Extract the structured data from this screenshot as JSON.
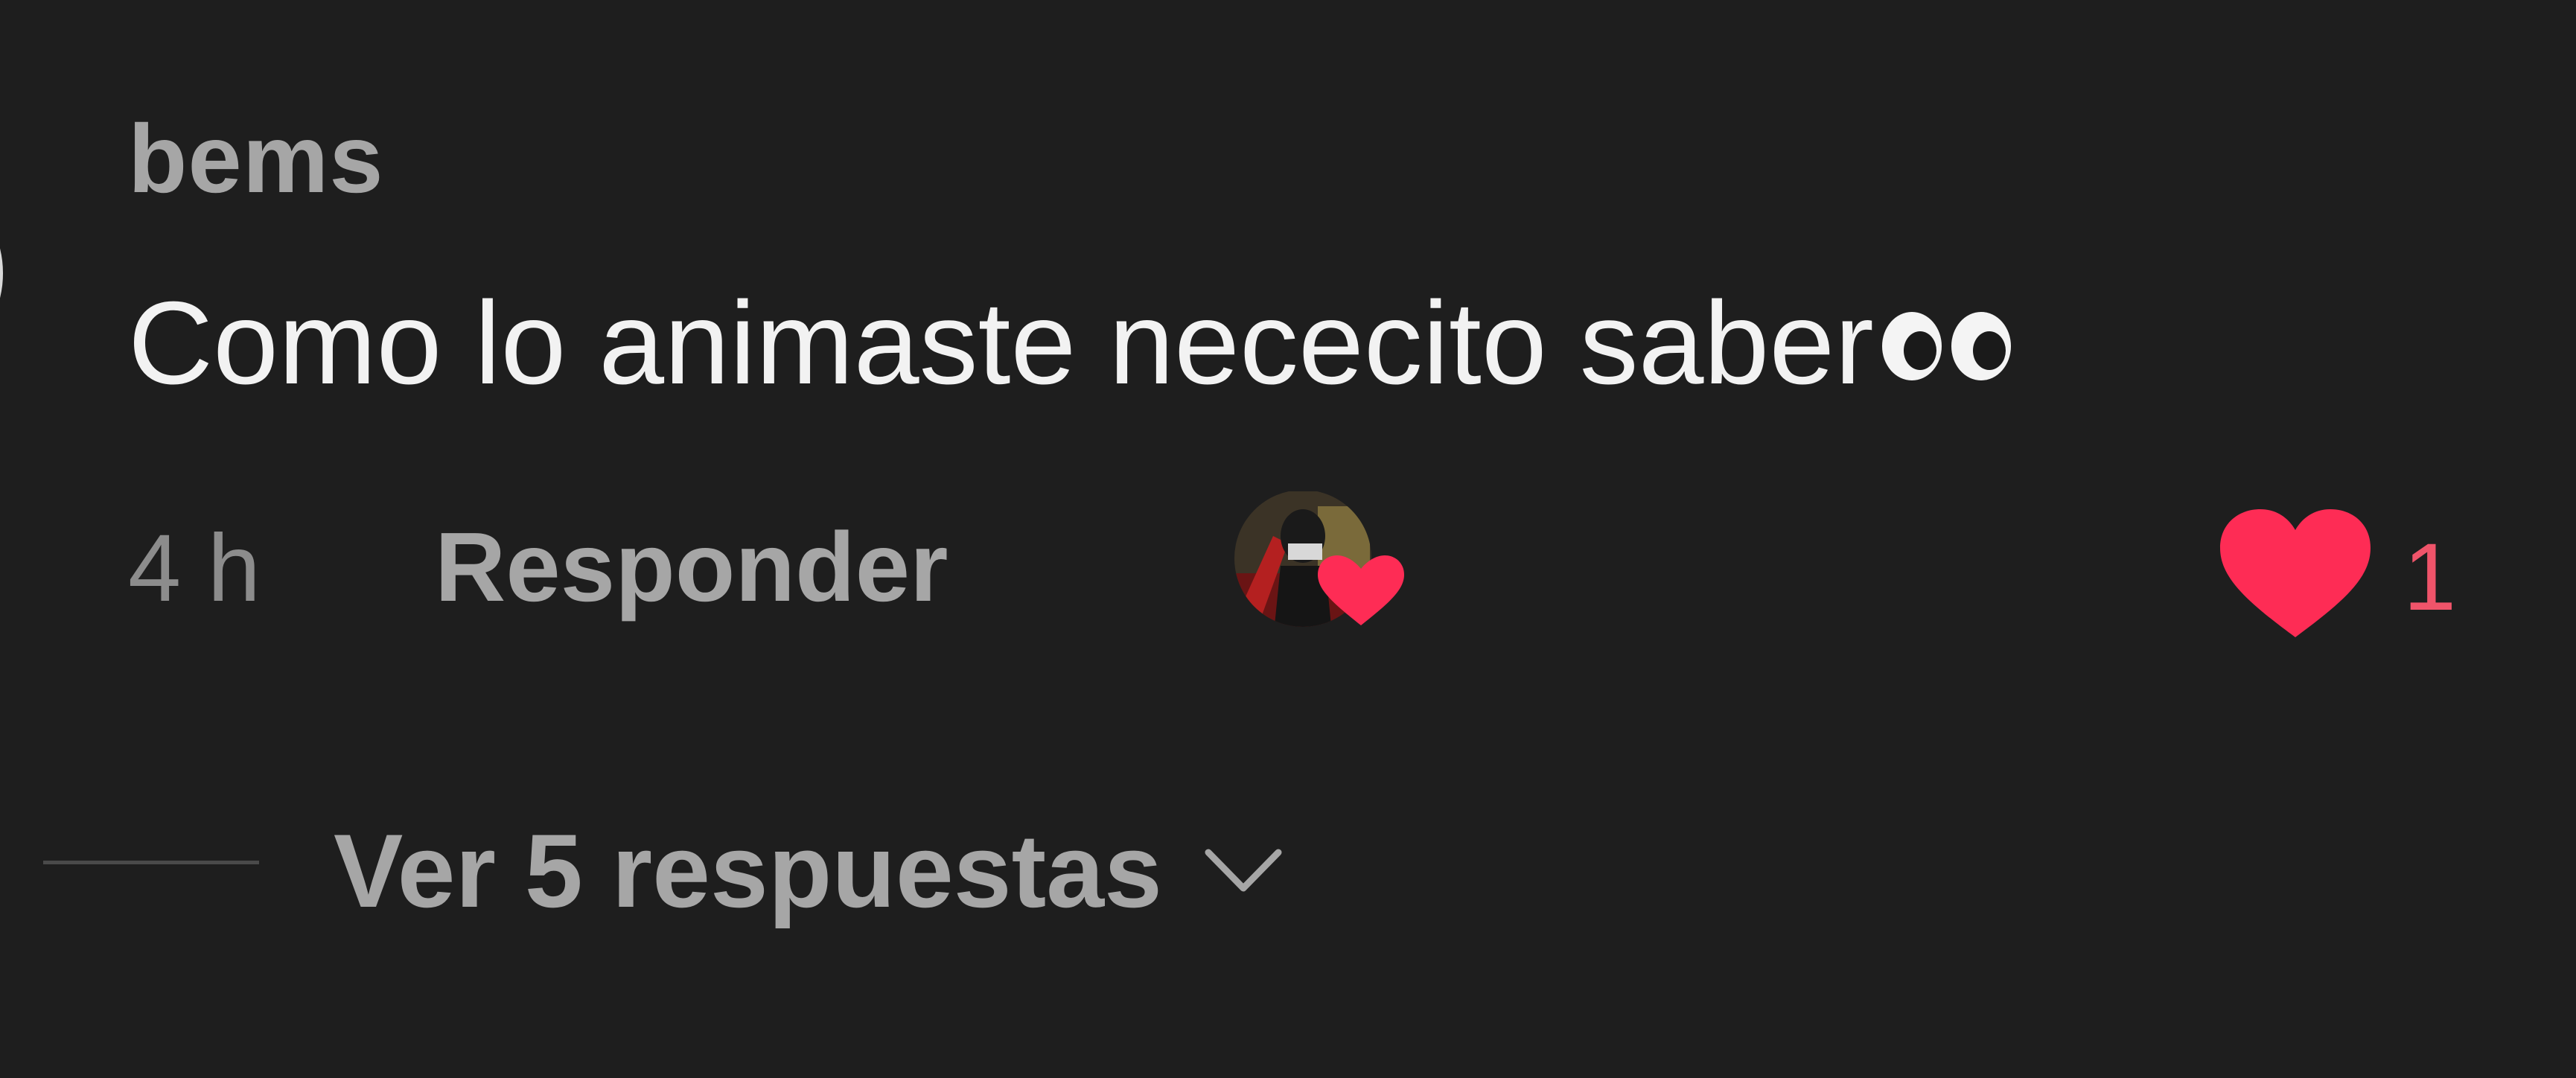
{
  "comment": {
    "username": "bems",
    "text": "Como lo animaste nececito saber",
    "emoji_icon": "eyes-icon",
    "time": "4 h",
    "reply_label": "Responder",
    "creator_liked": true,
    "like_count": "1",
    "view_replies_label": "Ver 5 respuestas"
  },
  "colors": {
    "background": "#1e1e1e",
    "like_heart": "#fe2c55",
    "username": "#a6a6a6",
    "comment_text": "#f2f2f2"
  }
}
